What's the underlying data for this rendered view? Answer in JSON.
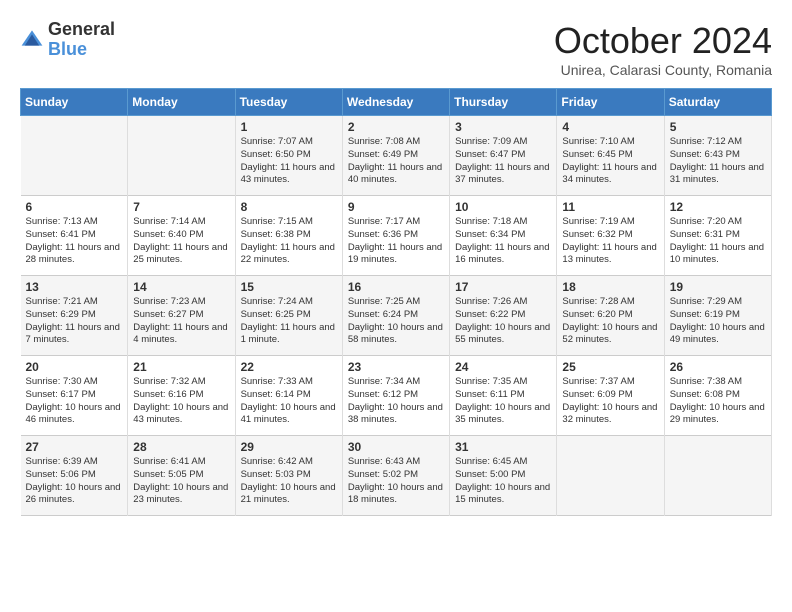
{
  "logo": {
    "general": "General",
    "blue": "Blue"
  },
  "title": "October 2024",
  "location": "Unirea, Calarasi County, Romania",
  "weekdays": [
    "Sunday",
    "Monday",
    "Tuesday",
    "Wednesday",
    "Thursday",
    "Friday",
    "Saturday"
  ],
  "weeks": [
    [
      {
        "day": "",
        "content": ""
      },
      {
        "day": "",
        "content": ""
      },
      {
        "day": "1",
        "content": "Sunrise: 7:07 AM\nSunset: 6:50 PM\nDaylight: 11 hours and 43 minutes."
      },
      {
        "day": "2",
        "content": "Sunrise: 7:08 AM\nSunset: 6:49 PM\nDaylight: 11 hours and 40 minutes."
      },
      {
        "day": "3",
        "content": "Sunrise: 7:09 AM\nSunset: 6:47 PM\nDaylight: 11 hours and 37 minutes."
      },
      {
        "day": "4",
        "content": "Sunrise: 7:10 AM\nSunset: 6:45 PM\nDaylight: 11 hours and 34 minutes."
      },
      {
        "day": "5",
        "content": "Sunrise: 7:12 AM\nSunset: 6:43 PM\nDaylight: 11 hours and 31 minutes."
      }
    ],
    [
      {
        "day": "6",
        "content": "Sunrise: 7:13 AM\nSunset: 6:41 PM\nDaylight: 11 hours and 28 minutes."
      },
      {
        "day": "7",
        "content": "Sunrise: 7:14 AM\nSunset: 6:40 PM\nDaylight: 11 hours and 25 minutes."
      },
      {
        "day": "8",
        "content": "Sunrise: 7:15 AM\nSunset: 6:38 PM\nDaylight: 11 hours and 22 minutes."
      },
      {
        "day": "9",
        "content": "Sunrise: 7:17 AM\nSunset: 6:36 PM\nDaylight: 11 hours and 19 minutes."
      },
      {
        "day": "10",
        "content": "Sunrise: 7:18 AM\nSunset: 6:34 PM\nDaylight: 11 hours and 16 minutes."
      },
      {
        "day": "11",
        "content": "Sunrise: 7:19 AM\nSunset: 6:32 PM\nDaylight: 11 hours and 13 minutes."
      },
      {
        "day": "12",
        "content": "Sunrise: 7:20 AM\nSunset: 6:31 PM\nDaylight: 11 hours and 10 minutes."
      }
    ],
    [
      {
        "day": "13",
        "content": "Sunrise: 7:21 AM\nSunset: 6:29 PM\nDaylight: 11 hours and 7 minutes."
      },
      {
        "day": "14",
        "content": "Sunrise: 7:23 AM\nSunset: 6:27 PM\nDaylight: 11 hours and 4 minutes."
      },
      {
        "day": "15",
        "content": "Sunrise: 7:24 AM\nSunset: 6:25 PM\nDaylight: 11 hours and 1 minute."
      },
      {
        "day": "16",
        "content": "Sunrise: 7:25 AM\nSunset: 6:24 PM\nDaylight: 10 hours and 58 minutes."
      },
      {
        "day": "17",
        "content": "Sunrise: 7:26 AM\nSunset: 6:22 PM\nDaylight: 10 hours and 55 minutes."
      },
      {
        "day": "18",
        "content": "Sunrise: 7:28 AM\nSunset: 6:20 PM\nDaylight: 10 hours and 52 minutes."
      },
      {
        "day": "19",
        "content": "Sunrise: 7:29 AM\nSunset: 6:19 PM\nDaylight: 10 hours and 49 minutes."
      }
    ],
    [
      {
        "day": "20",
        "content": "Sunrise: 7:30 AM\nSunset: 6:17 PM\nDaylight: 10 hours and 46 minutes."
      },
      {
        "day": "21",
        "content": "Sunrise: 7:32 AM\nSunset: 6:16 PM\nDaylight: 10 hours and 43 minutes."
      },
      {
        "day": "22",
        "content": "Sunrise: 7:33 AM\nSunset: 6:14 PM\nDaylight: 10 hours and 41 minutes."
      },
      {
        "day": "23",
        "content": "Sunrise: 7:34 AM\nSunset: 6:12 PM\nDaylight: 10 hours and 38 minutes."
      },
      {
        "day": "24",
        "content": "Sunrise: 7:35 AM\nSunset: 6:11 PM\nDaylight: 10 hours and 35 minutes."
      },
      {
        "day": "25",
        "content": "Sunrise: 7:37 AM\nSunset: 6:09 PM\nDaylight: 10 hours and 32 minutes."
      },
      {
        "day": "26",
        "content": "Sunrise: 7:38 AM\nSunset: 6:08 PM\nDaylight: 10 hours and 29 minutes."
      }
    ],
    [
      {
        "day": "27",
        "content": "Sunrise: 6:39 AM\nSunset: 5:06 PM\nDaylight: 10 hours and 26 minutes."
      },
      {
        "day": "28",
        "content": "Sunrise: 6:41 AM\nSunset: 5:05 PM\nDaylight: 10 hours and 23 minutes."
      },
      {
        "day": "29",
        "content": "Sunrise: 6:42 AM\nSunset: 5:03 PM\nDaylight: 10 hours and 21 minutes."
      },
      {
        "day": "30",
        "content": "Sunrise: 6:43 AM\nSunset: 5:02 PM\nDaylight: 10 hours and 18 minutes."
      },
      {
        "day": "31",
        "content": "Sunrise: 6:45 AM\nSunset: 5:00 PM\nDaylight: 10 hours and 15 minutes."
      },
      {
        "day": "",
        "content": ""
      },
      {
        "day": "",
        "content": ""
      }
    ]
  ]
}
